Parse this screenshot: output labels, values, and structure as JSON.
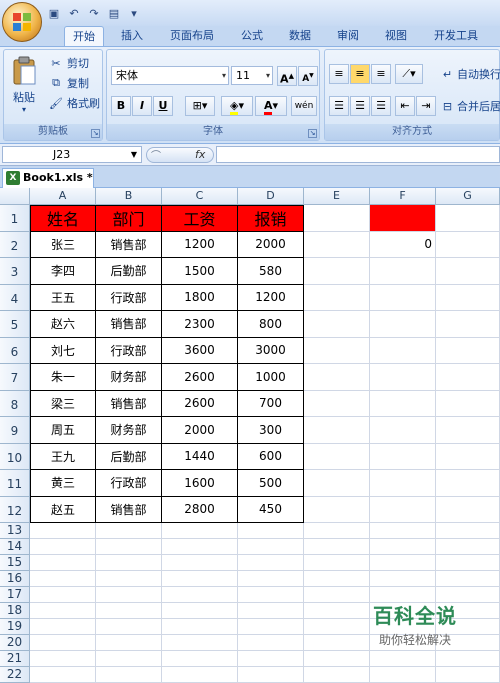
{
  "app": {
    "tabs": [
      "开始",
      "插入",
      "页面布局",
      "公式",
      "数据",
      "审阅",
      "视图",
      "开发工具"
    ],
    "active_tab": "开始"
  },
  "ribbon": {
    "clipboard": {
      "label": "剪贴板",
      "paste": "粘贴",
      "cut": "剪切",
      "copy": "复制",
      "format_painter": "格式刷"
    },
    "font": {
      "label": "字体",
      "font_name": "宋体",
      "font_size": "11",
      "bold": "B",
      "italic": "I",
      "underline": "U"
    },
    "align": {
      "label": "对齐方式",
      "wrap": "自动换行",
      "merge": "合并后居"
    }
  },
  "formula_bar": {
    "name_box": "J23",
    "fx": "fx",
    "value": ""
  },
  "document": {
    "tab": "Book1.xls *"
  },
  "sheet": {
    "columns": [
      "A",
      "B",
      "C",
      "D",
      "E",
      "F",
      "G"
    ],
    "headers": [
      "姓名",
      "部门",
      "工资",
      "报销"
    ],
    "rows": [
      [
        "张三",
        "销售部",
        "1200",
        "2000"
      ],
      [
        "李四",
        "后勤部",
        "1500",
        "580"
      ],
      [
        "王五",
        "行政部",
        "1800",
        "1200"
      ],
      [
        "赵六",
        "销售部",
        "2300",
        "800"
      ],
      [
        "刘七",
        "行政部",
        "3600",
        "3000"
      ],
      [
        "朱一",
        "财务部",
        "2600",
        "1000"
      ],
      [
        "梁三",
        "销售部",
        "2600",
        "700"
      ],
      [
        "周五",
        "财务部",
        "2000",
        "300"
      ],
      [
        "王九",
        "后勤部",
        "1440",
        "600"
      ],
      [
        "黄三",
        "行政部",
        "1600",
        "500"
      ],
      [
        "赵五",
        "销售部",
        "2800",
        "450"
      ]
    ],
    "row_numbers": [
      "1",
      "2",
      "3",
      "4",
      "5",
      "6",
      "7",
      "8",
      "9",
      "10",
      "11",
      "12",
      "13",
      "14",
      "15",
      "16",
      "17",
      "18",
      "19",
      "20",
      "21",
      "22"
    ],
    "f2_value": "0"
  },
  "watermark": {
    "title": "百科全说",
    "subtitle": "助你轻松解决"
  },
  "colors": {
    "header_fill": "#ff0000",
    "ribbon": "#cfe0f5",
    "watermark": "#2e8b57"
  }
}
